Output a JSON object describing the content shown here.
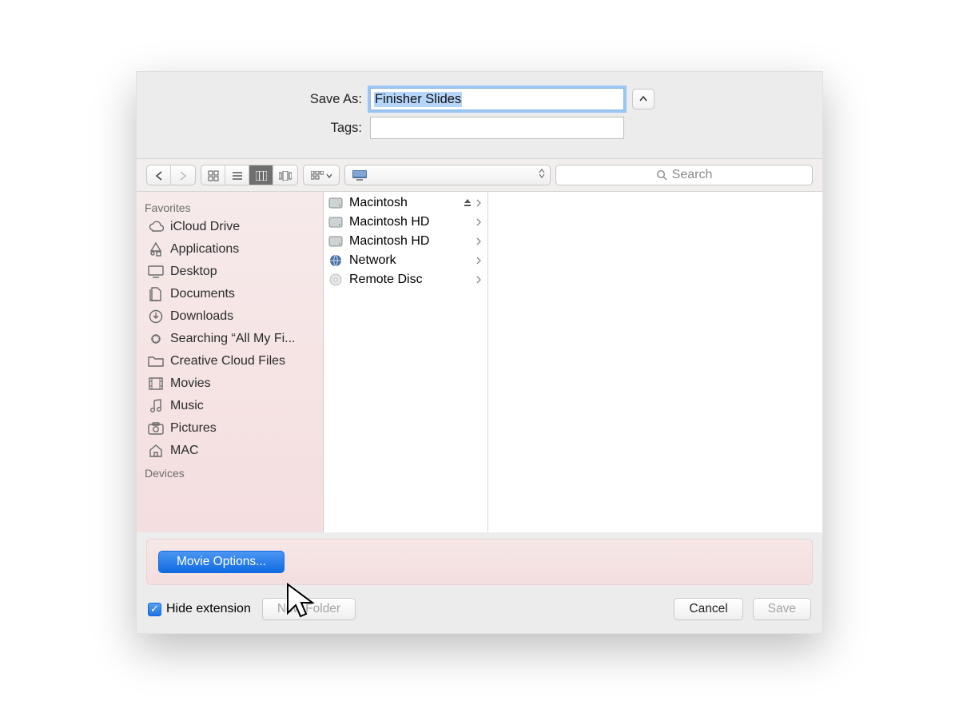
{
  "header": {
    "save_as_label": "Save As:",
    "save_as_value": "Finisher Slides",
    "tags_label": "Tags:",
    "tags_value": ""
  },
  "toolbar": {
    "location_text": "",
    "search_placeholder": "Search"
  },
  "sidebar": {
    "sections": [
      {
        "label": "Favorites",
        "items": [
          {
            "icon": "cloud",
            "label": "iCloud Drive"
          },
          {
            "icon": "apps",
            "label": "Applications"
          },
          {
            "icon": "desktop",
            "label": "Desktop"
          },
          {
            "icon": "documents",
            "label": "Documents"
          },
          {
            "icon": "downloads",
            "label": "Downloads"
          },
          {
            "icon": "search",
            "label": "Searching “All My Fi..."
          },
          {
            "icon": "folder",
            "label": "Creative Cloud Files"
          },
          {
            "icon": "movies",
            "label": "Movies"
          },
          {
            "icon": "music",
            "label": "Music"
          },
          {
            "icon": "pictures",
            "label": "Pictures"
          },
          {
            "icon": "home",
            "label": "MAC"
          }
        ]
      },
      {
        "label": "Devices",
        "items": []
      }
    ]
  },
  "column": {
    "items": [
      {
        "icon": "hdd",
        "label": "Macintosh",
        "eject": true
      },
      {
        "icon": "hdd",
        "label": "Macintosh HD",
        "eject": false
      },
      {
        "icon": "hdd",
        "label": "Macintosh HD",
        "eject": false
      },
      {
        "icon": "globe",
        "label": "Network",
        "eject": false
      },
      {
        "icon": "disc",
        "label": "Remote Disc",
        "eject": false
      }
    ]
  },
  "options": {
    "movie_options_label": "Movie Options..."
  },
  "bottom": {
    "hide_ext_label": "Hide extension",
    "hide_ext_checked": true,
    "new_folder_label": "New Folder",
    "cancel_label": "Cancel",
    "save_label": "Save"
  }
}
